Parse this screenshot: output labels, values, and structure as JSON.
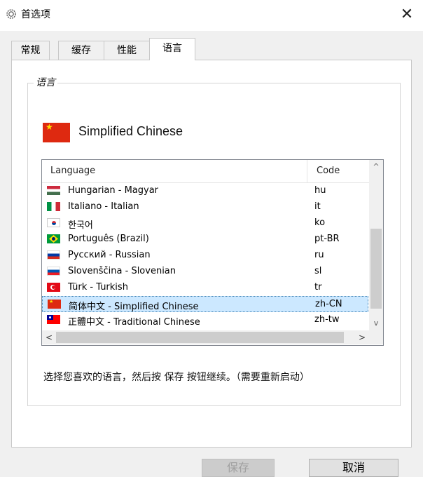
{
  "window": {
    "title": "首选项",
    "close_glyph": "✕",
    "title_icon": "gear-icon"
  },
  "tabs": [
    {
      "label": "常规",
      "active": false
    },
    {
      "label": "缓存",
      "active": false
    },
    {
      "label": "性能",
      "active": false
    },
    {
      "label": "语言",
      "active": true
    }
  ],
  "group": {
    "legend": "语言"
  },
  "current_language": {
    "name": "Simplified Chinese",
    "flag": "flag-china-icon"
  },
  "listview": {
    "columns": {
      "language": "Language",
      "code": "Code"
    },
    "rows": [
      {
        "name": "Hungarian - Magyar",
        "code": "hu",
        "flag": "f-hu",
        "selected": false
      },
      {
        "name": "Italiano - Italian",
        "code": "it",
        "flag": "f-it",
        "selected": false
      },
      {
        "name": "한국어",
        "code": "ko",
        "flag": "f-kr",
        "selected": false
      },
      {
        "name": "Português (Brazil)",
        "code": "pt-BR",
        "flag": "f-br",
        "selected": false
      },
      {
        "name": "Русский - Russian",
        "code": "ru",
        "flag": "f-ru",
        "selected": false
      },
      {
        "name": "Slovenščina - Slovenian",
        "code": "sl",
        "flag": "f-si",
        "selected": false
      },
      {
        "name": "Türk - Turkish",
        "code": "tr",
        "flag": "f-tr",
        "selected": false
      },
      {
        "name": "简体中文 - Simplified Chinese",
        "code": "zh-CN",
        "flag": "f-cn",
        "selected": true
      },
      {
        "name": "正體中文 - Traditional Chinese",
        "code": "zh-tw",
        "flag": "f-tw",
        "selected": false
      }
    ],
    "scroll": {
      "up": "^",
      "down": "v",
      "left": "<",
      "right": ">"
    }
  },
  "hint": "选择您喜欢的语言，然后按 保存 按钮继续。（需要重新启动）",
  "buttons": {
    "save": "保存",
    "cancel": "取消"
  },
  "colors": {
    "selection": "#cce8ff",
    "panel": "#ffffff",
    "background": "#f0f0f0"
  }
}
